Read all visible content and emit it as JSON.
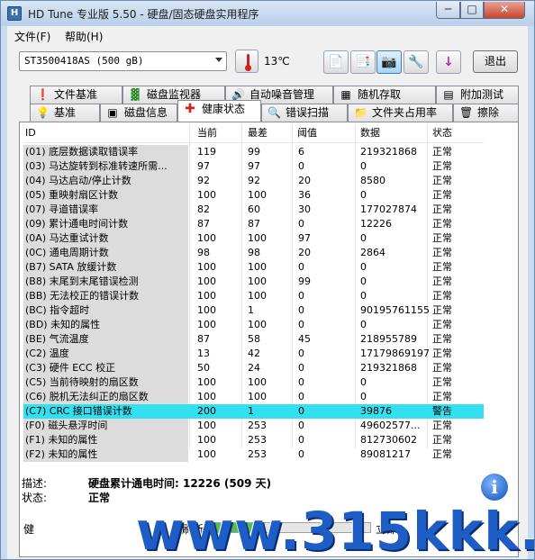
{
  "window": {
    "title": "HD Tune 专业版 5.50 - 硬盘/固态硬盘实用程序",
    "min": "─",
    "max": "□",
    "close": "✕"
  },
  "menu": {
    "file": "文件(F)",
    "help": "帮助(H)"
  },
  "toolbar": {
    "drive": "ST3500418AS (500 gB)",
    "temperature": "13℃",
    "exit": "退出",
    "buttons": [
      "copy-icon",
      "copy-all-icon",
      "camera-icon",
      "settings-icon",
      "download-icon"
    ]
  },
  "tabs_top": [
    {
      "label": "文件基准",
      "icon": "file-benchmark-icon"
    },
    {
      "label": "磁盘监视器",
      "icon": "disk-monitor-icon"
    },
    {
      "label": "自动噪音管理",
      "icon": "speaker-icon"
    },
    {
      "label": "随机存取",
      "icon": "random-access-icon"
    },
    {
      "label": "附加测试",
      "icon": "extra-tests-icon"
    }
  ],
  "tabs_bottom": [
    {
      "label": "基准",
      "icon": "benchmark-icon"
    },
    {
      "label": "磁盘信息",
      "icon": "disk-info-icon"
    },
    {
      "label": "健康状态",
      "icon": "health-icon",
      "selected": true
    },
    {
      "label": "错误扫描",
      "icon": "error-scan-icon"
    },
    {
      "label": "文件夹占用率",
      "icon": "folder-icon"
    },
    {
      "label": "擦除",
      "icon": "erase-icon"
    }
  ],
  "columns": [
    "ID",
    "当前",
    "最差",
    "阈值",
    "数据",
    "状态"
  ],
  "rows": [
    {
      "id": "(01) 底层数据读取错误率",
      "cur": "119",
      "worst": "99",
      "thr": "6",
      "data": "219321868",
      "status": "正常"
    },
    {
      "id": "(03) 马达旋转到标准转速所需...",
      "cur": "97",
      "worst": "97",
      "thr": "0",
      "data": "0",
      "status": "正常"
    },
    {
      "id": "(04) 马达启动/停止计数",
      "cur": "92",
      "worst": "92",
      "thr": "20",
      "data": "8580",
      "status": "正常"
    },
    {
      "id": "(05) 重映射扇区计数",
      "cur": "100",
      "worst": "100",
      "thr": "36",
      "data": "0",
      "status": "正常"
    },
    {
      "id": "(07) 寻道错误率",
      "cur": "82",
      "worst": "60",
      "thr": "30",
      "data": "177027874",
      "status": "正常"
    },
    {
      "id": "(09) 累计通电时间计数",
      "cur": "87",
      "worst": "87",
      "thr": "0",
      "data": "12226",
      "status": "正常"
    },
    {
      "id": "(0A) 马达重试计数",
      "cur": "100",
      "worst": "100",
      "thr": "97",
      "data": "0",
      "status": "正常"
    },
    {
      "id": "(0C) 通电周期计数",
      "cur": "98",
      "worst": "98",
      "thr": "20",
      "data": "2864",
      "status": "正常"
    },
    {
      "id": "(B7) SATA 放缓计数",
      "cur": "100",
      "worst": "100",
      "thr": "0",
      "data": "0",
      "status": "正常"
    },
    {
      "id": "(B8) 末尾到末尾错误检测",
      "cur": "100",
      "worst": "100",
      "thr": "99",
      "data": "0",
      "status": "正常"
    },
    {
      "id": "(BB) 无法校正的错误计数",
      "cur": "100",
      "worst": "100",
      "thr": "0",
      "data": "0",
      "status": "正常"
    },
    {
      "id": "(BC) 指令超时",
      "cur": "100",
      "worst": "1",
      "thr": "0",
      "data": "90195761155",
      "status": "正常"
    },
    {
      "id": "(BD) 未知的属性",
      "cur": "100",
      "worst": "100",
      "thr": "0",
      "data": "0",
      "status": "正常"
    },
    {
      "id": "(BE) 气流温度",
      "cur": "87",
      "worst": "58",
      "thr": "45",
      "data": "218955789",
      "status": "正常"
    },
    {
      "id": "(C2) 温度",
      "cur": "13",
      "worst": "42",
      "thr": "0",
      "data": "17179869197",
      "status": "正常"
    },
    {
      "id": "(C3) 硬件 ECC 校正",
      "cur": "50",
      "worst": "24",
      "thr": "0",
      "data": "219321868",
      "status": "正常"
    },
    {
      "id": "(C5) 当前待映射的扇区数",
      "cur": "100",
      "worst": "100",
      "thr": "0",
      "data": "0",
      "status": "正常"
    },
    {
      "id": "(C6) 脱机无法纠正的扇区数",
      "cur": "100",
      "worst": "100",
      "thr": "0",
      "data": "0",
      "status": "正常"
    },
    {
      "id": "(C7) CRC 接口错误计数",
      "cur": "200",
      "worst": "1",
      "thr": "0",
      "data": "39876",
      "status": "警告",
      "highlight": true
    },
    {
      "id": "(F0) 磁头悬浮时间",
      "cur": "100",
      "worst": "253",
      "thr": "0",
      "data": "49602577...",
      "status": "正常"
    },
    {
      "id": "(F1) 未知的属性",
      "cur": "100",
      "worst": "253",
      "thr": "0",
      "data": "812730602",
      "status": "正常"
    },
    {
      "id": "(F2) 未知的属性",
      "cur": "100",
      "worst": "253",
      "thr": "0",
      "data": "89081217",
      "status": "正常"
    }
  ],
  "description": {
    "label_desc": "描述:",
    "desc_text": "硬盘累计通电时间: 12226 (509 天)",
    "label_status": "状态:",
    "status_text": "正常"
  },
  "statusbar": {
    "left": "健",
    "mid": "刷新",
    "right": "立即"
  },
  "watermark": "www.315kkk.com"
}
